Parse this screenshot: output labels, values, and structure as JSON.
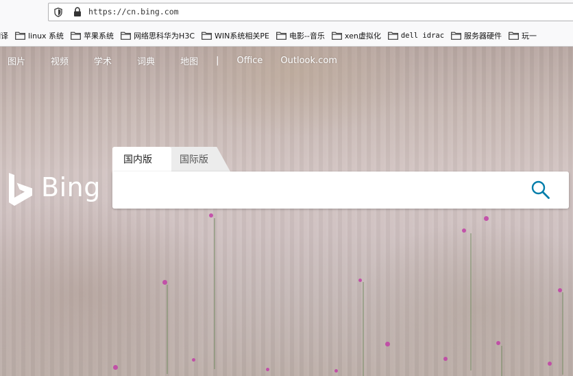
{
  "browser": {
    "url": "https://cn.bing.com",
    "bookmarks": [
      {
        "label": "翻译",
        "mono": false
      },
      {
        "label": "linux 系统",
        "mono": false
      },
      {
        "label": "苹果系统",
        "mono": false
      },
      {
        "label": "网络思科华为H3C",
        "mono": false
      },
      {
        "label": "WIN系统相关PE",
        "mono": false
      },
      {
        "label": "电影--音乐",
        "mono": false
      },
      {
        "label": "xen虚拟化",
        "mono": false
      },
      {
        "label": "dell idrac",
        "mono": true
      },
      {
        "label": "服务器硬件",
        "mono": false
      },
      {
        "label": "玩一",
        "mono": false
      }
    ]
  },
  "nav": {
    "items": [
      "图片",
      "视频",
      "学术",
      "词典",
      "地图"
    ],
    "separator": "|",
    "links": [
      "Office",
      "Outlook.com"
    ]
  },
  "logo": {
    "text": "Bing"
  },
  "search": {
    "tabs": {
      "domestic": "国内版",
      "international": "国际版"
    },
    "value": "",
    "placeholder": ""
  },
  "colors": {
    "accent": "#007daa",
    "nav_text": "#ffffff"
  },
  "icons": [
    "shield-icon",
    "lock-icon",
    "folder-icon",
    "bing-logo-icon",
    "search-icon"
  ]
}
